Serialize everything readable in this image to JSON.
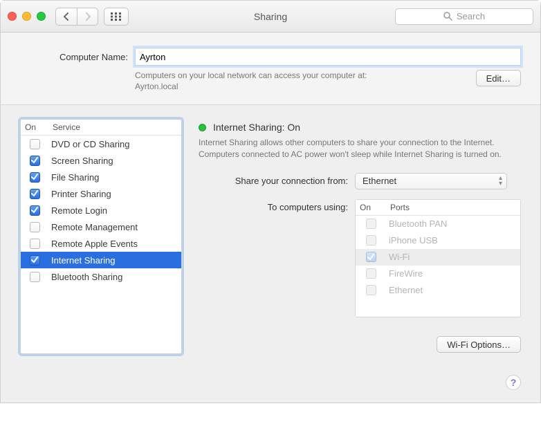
{
  "window": {
    "title": "Sharing",
    "search_placeholder": "Search"
  },
  "computer_name": {
    "label": "Computer Name:",
    "value": "Ayrton",
    "hint_line1": "Computers on your local network can access your computer at:",
    "hint_line2": "Ayrton.local",
    "edit_label": "Edit…"
  },
  "services": {
    "col_on": "On",
    "col_service": "Service",
    "items": [
      {
        "label": "DVD or CD Sharing",
        "checked": false,
        "selected": false
      },
      {
        "label": "Screen Sharing",
        "checked": true,
        "selected": false
      },
      {
        "label": "File Sharing",
        "checked": true,
        "selected": false
      },
      {
        "label": "Printer Sharing",
        "checked": true,
        "selected": false
      },
      {
        "label": "Remote Login",
        "checked": true,
        "selected": false
      },
      {
        "label": "Remote Management",
        "checked": false,
        "selected": false
      },
      {
        "label": "Remote Apple Events",
        "checked": false,
        "selected": false
      },
      {
        "label": "Internet Sharing",
        "checked": true,
        "selected": true
      },
      {
        "label": "Bluetooth Sharing",
        "checked": false,
        "selected": false
      }
    ]
  },
  "detail": {
    "status_title": "Internet Sharing: On",
    "description": "Internet Sharing allows other computers to share your connection to the Internet. Computers connected to AC power won't sleep while Internet Sharing is turned on.",
    "share_from_label": "Share your connection from:",
    "share_from_value": "Ethernet",
    "to_label": "To computers using:",
    "ports": {
      "col_on": "On",
      "col_ports": "Ports",
      "items": [
        {
          "label": "Bluetooth PAN",
          "checked": false,
          "selected": false
        },
        {
          "label": "iPhone USB",
          "checked": false,
          "selected": false
        },
        {
          "label": "Wi-Fi",
          "checked": true,
          "selected": true
        },
        {
          "label": "FireWire",
          "checked": false,
          "selected": false
        },
        {
          "label": "Ethernet",
          "checked": false,
          "selected": false
        }
      ]
    },
    "wifi_options_label": "Wi-Fi Options…"
  },
  "help_label": "?"
}
